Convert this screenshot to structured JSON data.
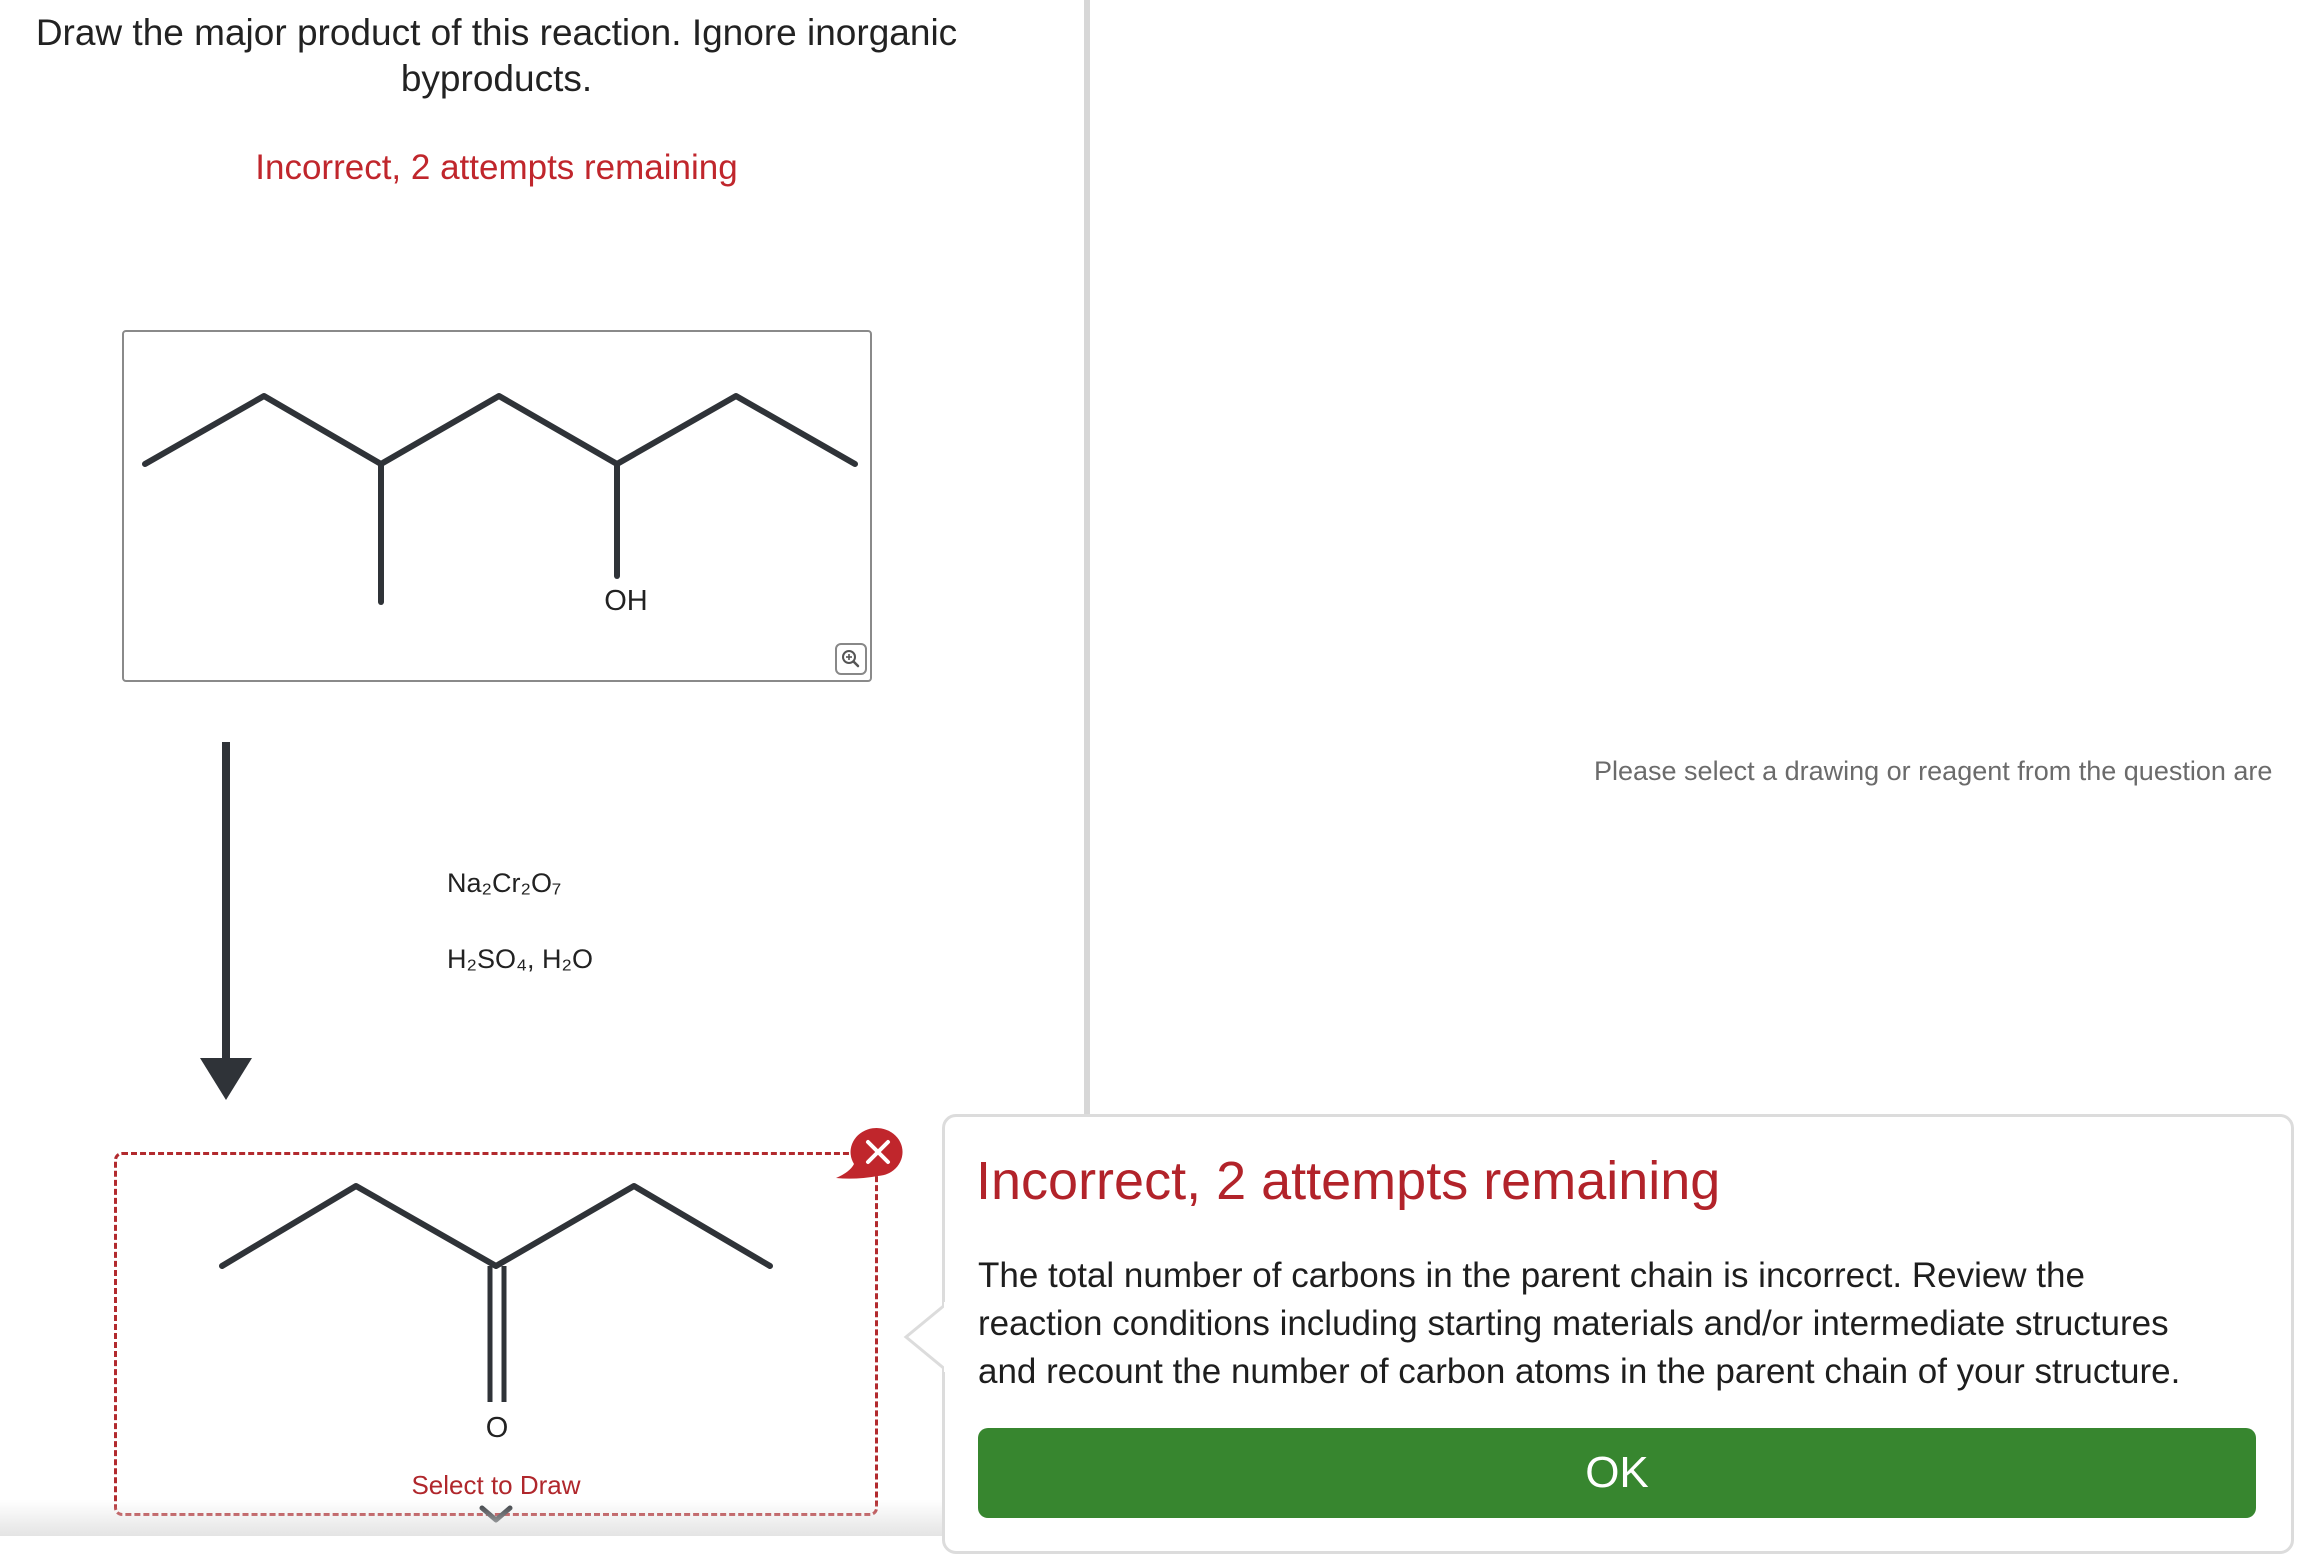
{
  "question": {
    "line1": "Draw the major product of this reaction. Ignore inorganic",
    "line2": "byproducts."
  },
  "status_message": "Incorrect, 2 attempts remaining",
  "reactant": {
    "label_oh": "OH"
  },
  "reagents": {
    "line1": "Na₂Cr₂O₇",
    "line2": "H₂SO₄, H₂O"
  },
  "product": {
    "label_o": "O",
    "select_to_draw": "Select to Draw"
  },
  "right_panel": {
    "placeholder": "Please select a drawing or reagent from the question are"
  },
  "feedback": {
    "title": "Incorrect, 2 attempts remaining",
    "line1": "The total number of carbons in the parent chain is incorrect. Review the",
    "line2": "reaction conditions including starting materials and/or intermediate structures",
    "line3": "and recount the number of carbon atoms in the parent chain of your structure.",
    "ok_label": "OK"
  },
  "icons": {
    "zoom": "zoom-in-icon",
    "remove": "close-icon",
    "expand": "chevron-down-icon",
    "arrow": "reaction-arrow-icon"
  },
  "colors": {
    "error_red": "#c0262c",
    "ok_green": "#37862f",
    "bond": "#2f3338",
    "divider": "#d7d7d7"
  }
}
